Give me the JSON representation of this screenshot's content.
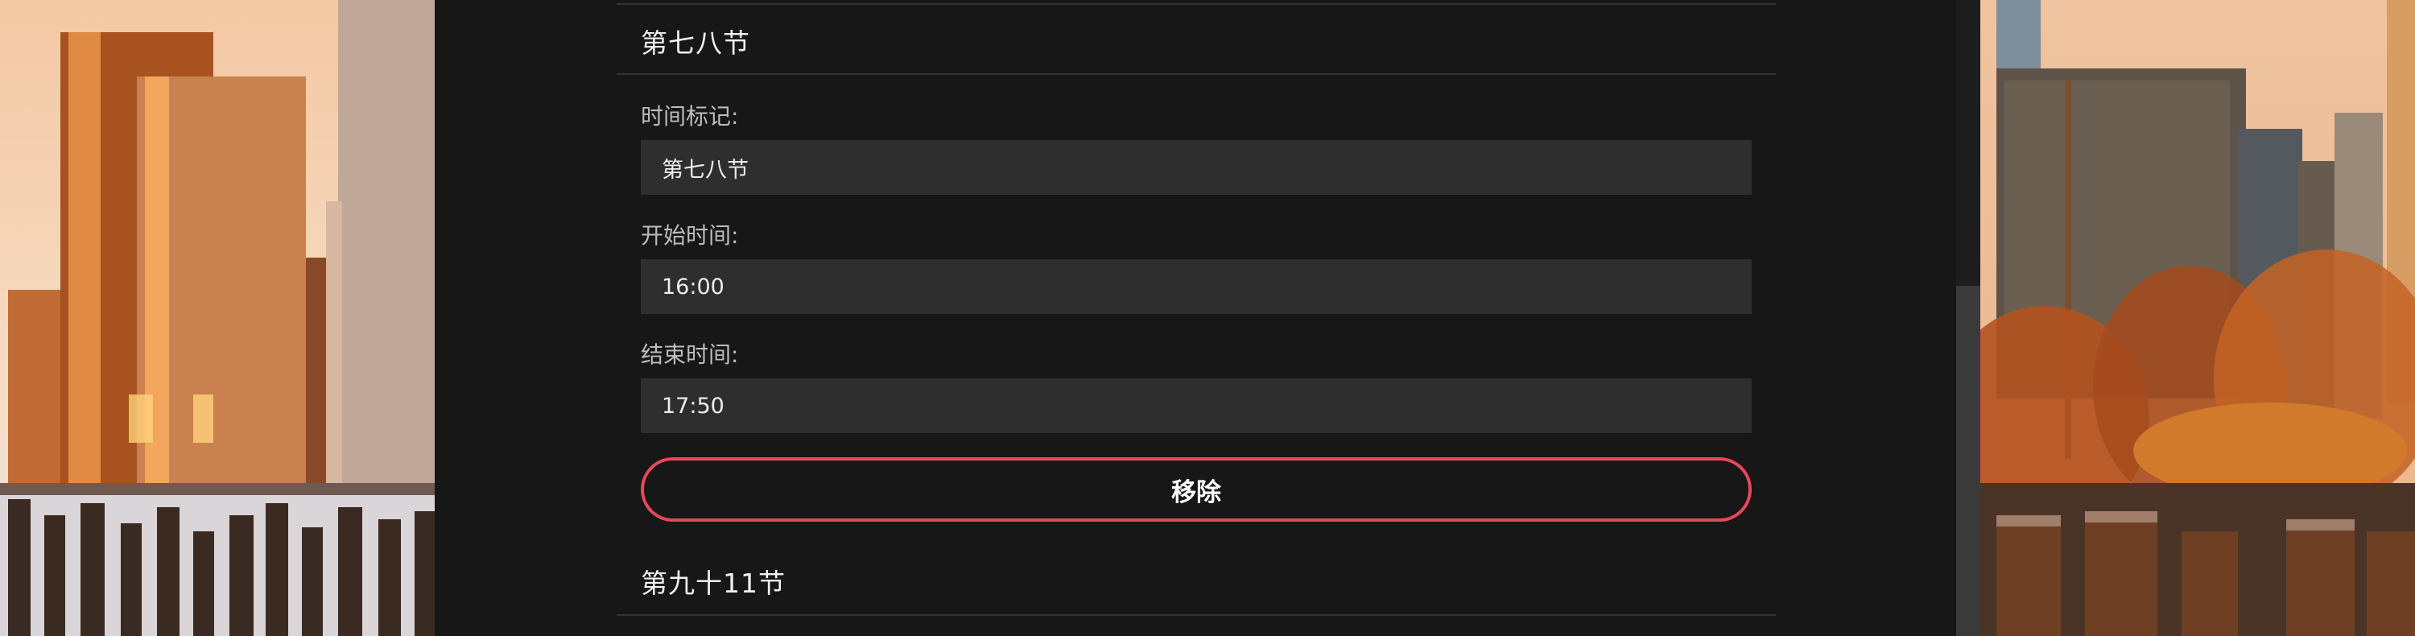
{
  "section1": {
    "title": "第七八节",
    "time_label": {
      "label": "时间标记:",
      "value": "第七八节"
    },
    "start_time": {
      "label": "开始时间:",
      "value": "16:00"
    },
    "end_time": {
      "label": "结束时间:",
      "value": "17:50"
    },
    "remove_label": "移除"
  },
  "section2": {
    "title": "第九十11节"
  },
  "colors": {
    "background": "#171717",
    "input_background": "#2e2e2e",
    "remove_border": "#e8485b"
  }
}
